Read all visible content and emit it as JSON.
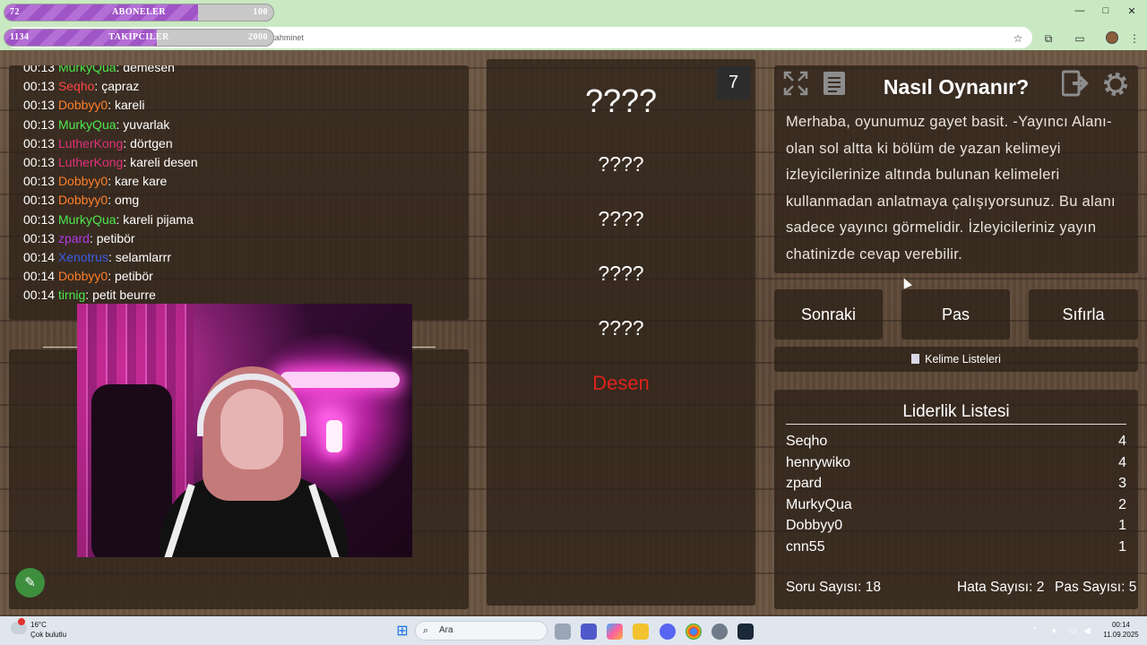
{
  "browser": {
    "url": "…games.com.tr/index.php…e=tahminet",
    "window_controls": [
      "—",
      "□",
      "✕"
    ]
  },
  "overlay": {
    "subscribers": {
      "current": "72",
      "label": "ABONELER",
      "goal": "100",
      "progress": 0.72
    },
    "followers": {
      "current": "1134",
      "label": "TAKIPCILER",
      "goal": "2000",
      "progress": 0.567
    }
  },
  "chat": {
    "messages": [
      {
        "time": "00:13",
        "user": "MurkyQua",
        "color": "#4ee84e",
        "text": "demesen"
      },
      {
        "time": "00:13",
        "user": "Seqho",
        "color": "#ff4646",
        "text": "çapraz"
      },
      {
        "time": "00:13",
        "user": "Dobbyy0",
        "color": "#ff7f2a",
        "text": "kareli"
      },
      {
        "time": "00:13",
        "user": "MurkyQua",
        "color": "#4ee84e",
        "text": "yuvarlak"
      },
      {
        "time": "00:13",
        "user": "LutherKong",
        "color": "#e0307a",
        "text": "dörtgen"
      },
      {
        "time": "00:13",
        "user": "LutherKong",
        "color": "#e0307a",
        "text": "kareli desen"
      },
      {
        "time": "00:13",
        "user": "Dobbyy0",
        "color": "#ff7f2a",
        "text": "kare kare"
      },
      {
        "time": "00:13",
        "user": "Dobbyy0",
        "color": "#ff7f2a",
        "text": "omg"
      },
      {
        "time": "00:13",
        "user": "MurkyQua",
        "color": "#4ee84e",
        "text": "kareli pijama"
      },
      {
        "time": "00:13",
        "user": "zpard",
        "color": "#b23ae8",
        "text": "petibör"
      },
      {
        "time": "00:14",
        "user": "Xenotrus",
        "color": "#3a5fe8",
        "text": "selamlarrr"
      },
      {
        "time": "00:14",
        "user": "Dobbyy0",
        "color": "#ff7f2a",
        "text": "petibör"
      },
      {
        "time": "00:14",
        "user": "tirnig",
        "color": "#4ee84e",
        "text": "petit beurre"
      }
    ]
  },
  "game": {
    "counter": "7",
    "hidden_words": [
      "????",
      "????",
      "????",
      "????",
      "????"
    ],
    "forbidden_word": "Desen",
    "how_to_title": "Nasıl Oynanır?",
    "how_to_text": "Merhaba, oyunumuz gayet basit. -Yayıncı Alanı- olan sol altta ki bölüm de yazan kelimeyi izleyicilerinize altında bulunan kelimeleri kullanmadan anlatmaya çalışıyorsunuz. Bu alanı sadece yayıncı görmelidir. İzleyicileriniz yayın chatinizde cevap verebilir.",
    "buttons": {
      "next": "Sonraki",
      "pass": "Pas",
      "reset": "Sıfırla"
    },
    "word_lists": "Kelime Listeleri",
    "icons": [
      "fullscreen-icon",
      "notes-icon",
      "exit-icon",
      "gear-icon"
    ]
  },
  "leaderboard": {
    "title": "Liderlik Listesi",
    "rows": [
      {
        "name": "Seqho",
        "score": "4"
      },
      {
        "name": "henrywiko",
        "score": "4"
      },
      {
        "name": "zpard",
        "score": "3"
      },
      {
        "name": "MurkyQua",
        "score": "2"
      },
      {
        "name": "Dobbyy0",
        "score": "1"
      },
      {
        "name": "cnn55",
        "score": "1"
      }
    ],
    "stats": {
      "questions": "Soru Sayısı: 18",
      "errors": "Hata Sayısı: 2",
      "passes": "Pas Sayısı: 5"
    }
  },
  "taskbar": {
    "weather_temp": "16°C",
    "weather_desc": "Çok bulutlu",
    "search_placeholder": "Ara",
    "time": "00:14",
    "date": "11.09.2025"
  }
}
